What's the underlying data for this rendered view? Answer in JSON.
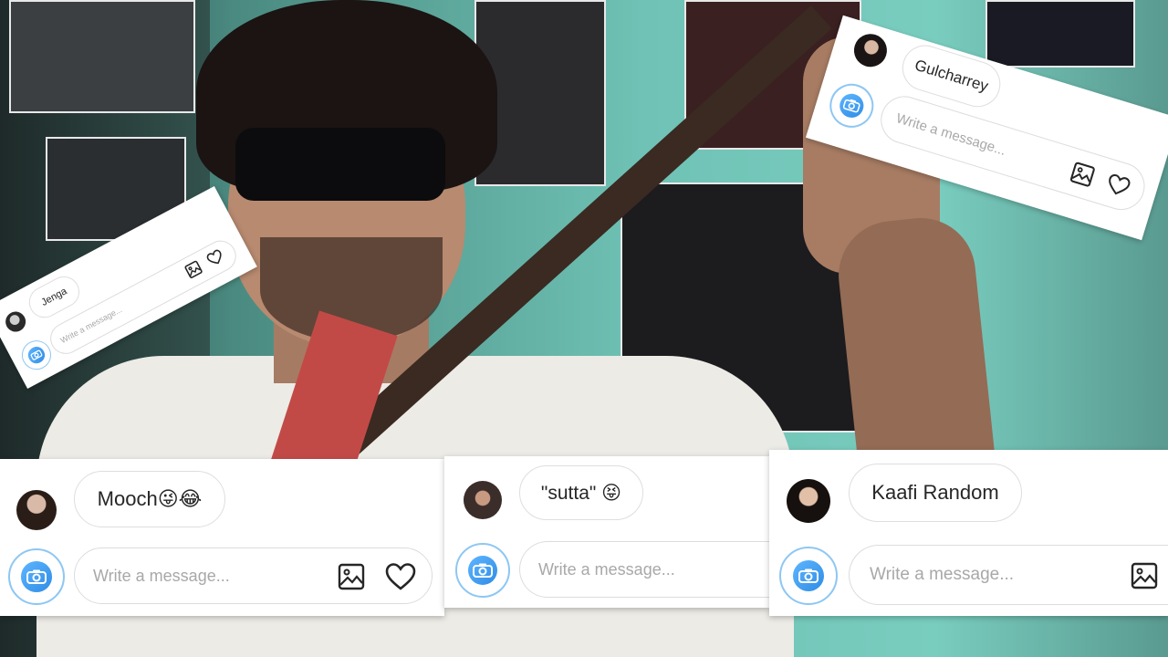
{
  "overlays": {
    "mooch": {
      "message": "Mooch😜😂",
      "placeholder": "Write a message..."
    },
    "sutta": {
      "message": "\"sutta\" 😝",
      "placeholder": "Write a message..."
    },
    "kaafi": {
      "message": "Kaafi Random",
      "placeholder": "Write a message..."
    },
    "gulcharrey": {
      "message": "Gulcharrey",
      "placeholder": "Write a message..."
    },
    "jenga": {
      "message": "Jenga",
      "placeholder": "Write a message..."
    }
  },
  "icons": {
    "camera": "camera-icon",
    "gallery": "image-gallery-icon",
    "like": "heart-icon"
  },
  "colors": {
    "accent_blue": "#3897f0",
    "wall_teal": "#6fc2b5",
    "card_white": "#ffffff"
  }
}
